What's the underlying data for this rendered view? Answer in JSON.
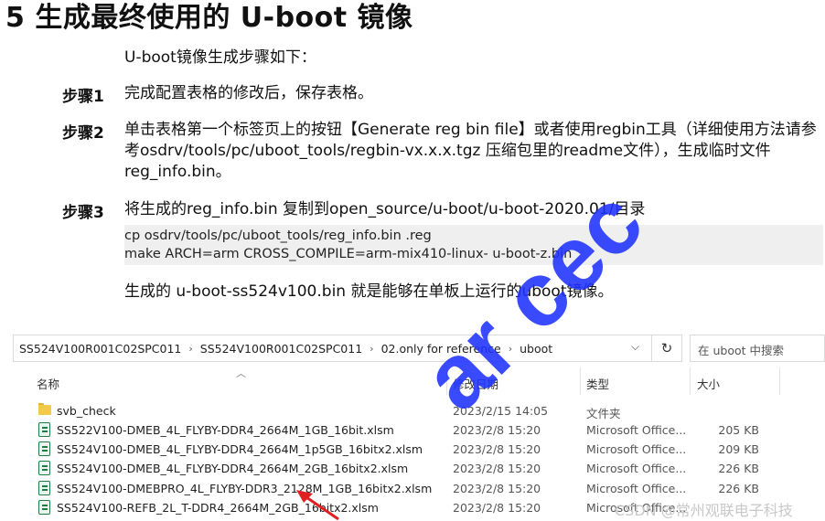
{
  "doc": {
    "title": "5 生成最终使用的 U-boot 镜像",
    "intro": "U-boot镜像生成步骤如下：",
    "steps": [
      {
        "label": "步骤1",
        "text": "完成配置表格的修改后，保存表格。"
      },
      {
        "label": "步骤2",
        "text": "单击表格第一个标签页上的按钮【Generate reg bin file】或者使用regbin工具（详细使用方法请参考osdrv/tools/pc/uboot_tools/regbin-vx.x.x.tgz 压缩包里的readme文件），生成临时文件reg_info.bin。"
      },
      {
        "label": "步骤3",
        "text": "将生成的reg_info.bin 复制到open_source/u-boot/u-boot-2020.01/目录"
      }
    ],
    "code_lines": [
      "cp osdrv/tools/pc/uboot_tools/reg_info.bin .reg",
      "make ARCH=arm CROSS_COMPILE=arm-mix410-linux- u-boot-z.bin"
    ],
    "result": "生成的 u-boot-ss524v100.bin 就是能够在单板上运行的uboot镜像。"
  },
  "watermark": {
    "text": "ar cec",
    "color": "#1f33ff"
  },
  "explorer": {
    "breadcrumb": [
      "SS524V100R001C02SPC011",
      "SS524V100R001C02SPC011",
      "02.only for reference",
      "uboot"
    ],
    "search_placeholder": "在 uboot 中搜索",
    "columns": {
      "name": "名称",
      "date": "修改日期",
      "type": "类型",
      "size": "大小"
    },
    "files": [
      {
        "icon": "folder-icon",
        "name": "svb_check",
        "date": "2023/2/15 14:05",
        "type": "文件夹",
        "size": ""
      },
      {
        "icon": "excel-file-icon",
        "name": "SS522V100-DMEB_4L_FLYBY-DDR4_2664M_1GB_16bit.xlsm",
        "date": "2023/2/8 15:20",
        "type": "Microsoft Office...",
        "size": "205 KB"
      },
      {
        "icon": "excel-file-icon",
        "name": "SS524V100-DMEB_4L_FLYBY-DDR4_2664M_1p5GB_16bitx2.xlsm",
        "date": "2023/2/8 15:20",
        "type": "Microsoft Office...",
        "size": "209 KB"
      },
      {
        "icon": "excel-file-icon",
        "name": "SS524V100-DMEB_4L_FLYBY-DDR4_2664M_2GB_16bitx2.xlsm",
        "date": "2023/2/8 15:20",
        "type": "Microsoft Office...",
        "size": "226 KB"
      },
      {
        "icon": "excel-file-icon",
        "name": "SS524V100-DMEBPRO_4L_FLYBY-DDR3_2128M_1GB_16bitx2.xlsm",
        "date": "2023/2/8 15:20",
        "type": "Microsoft Office...",
        "size": "226 KB"
      },
      {
        "icon": "excel-file-icon",
        "name": "SS524V100-REFB_2L_T-DDR4_2664M_2GB_16bitx2.xlsm",
        "date": "2023/2/8 15:20",
        "type": "Microsoft Office...",
        "size": ""
      }
    ]
  },
  "annotation_arrow": {
    "color": "#e02020"
  },
  "credit": "CSDN @常州观联电子科技"
}
